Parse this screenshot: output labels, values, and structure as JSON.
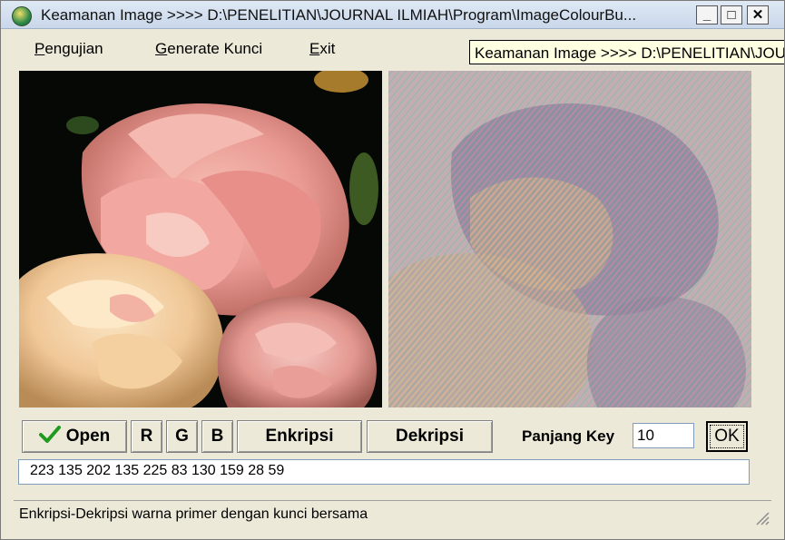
{
  "window": {
    "title": "Keamanan Image >>>> D:\\PENELITIAN\\JOURNAL ILMIAH\\Program\\ImageColourBu...",
    "controls": {
      "minimize": "_",
      "maximize": "□",
      "close": "✕"
    }
  },
  "tooltip": {
    "text": "Keamanan Image >>>> D:\\PENELITIAN\\JOURNAL ILMIAH\\Program\\ImageColourBu"
  },
  "menu": {
    "items": [
      {
        "underline": "P",
        "rest": "engujian"
      },
      {
        "underline": "G",
        "rest": "enerate Kunci"
      },
      {
        "underline": "E",
        "rest": "xit"
      }
    ]
  },
  "buttons": {
    "open": "Open",
    "r": "R",
    "g": "G",
    "b": "B",
    "enkripsi": "Enkripsi",
    "dekripsi": "Dekripsi",
    "ok": "OK"
  },
  "key": {
    "label": "Panjang Key",
    "value": "10"
  },
  "output": {
    "value": "223  135  202  135  225  83  130  159  28  59"
  },
  "status": {
    "text": "Enkripsi-Dekripsi warna primer dengan kunci bersama"
  },
  "icons": {
    "check": "check-icon",
    "app": "app-icon"
  }
}
